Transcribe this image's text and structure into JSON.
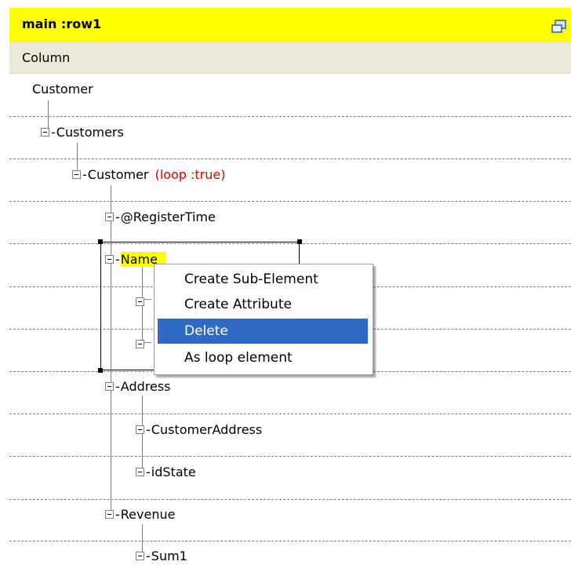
{
  "header": {
    "title": "main :row1",
    "window_icon": "restore-window-icon",
    "accent": "#ffff00"
  },
  "column_header": {
    "label": "Column"
  },
  "tree": {
    "root": "Customer",
    "nodes": [
      {
        "label": "Customers"
      },
      {
        "label": "Customer",
        "note": "(loop :true)"
      },
      {
        "label": "@RegisterTime"
      },
      {
        "label": "Name"
      },
      {
        "label": "Address"
      },
      {
        "label": "CustomerAddress"
      },
      {
        "label": "idState"
      },
      {
        "label": "Revenue"
      },
      {
        "label": "Sum1"
      }
    ],
    "loop_color": "#e00000"
  },
  "context_menu": {
    "items": [
      {
        "label": "Create Sub-Element"
      },
      {
        "label": "Create Attribute"
      },
      {
        "label": "Delete",
        "highlighted": true
      },
      {
        "label": "As loop element"
      }
    ],
    "highlight_color": "#316ac5"
  }
}
